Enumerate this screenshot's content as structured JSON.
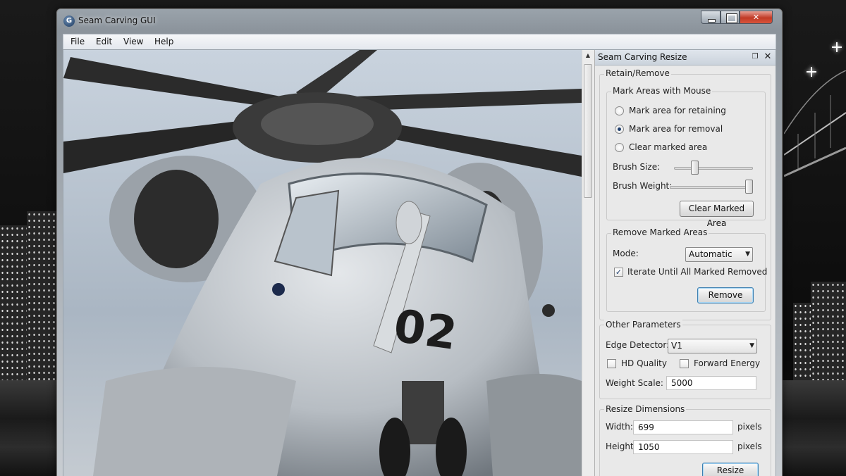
{
  "window": {
    "title": "Seam Carving GUI",
    "app_icon_letter": "G",
    "close_symbol": "✕"
  },
  "menu": [
    "File",
    "Edit",
    "View",
    "Help"
  ],
  "canvas": {
    "aircraft_marking": "02"
  },
  "dock": {
    "title": "Seam Carving Resize",
    "float_symbol": "❐",
    "close_symbol": "✕",
    "retain_remove": {
      "title": "Retain/Remove",
      "mark_areas": {
        "title": "Mark Areas with Mouse",
        "options": [
          "Mark area for retaining",
          "Mark area for removal",
          "Clear marked area"
        ],
        "selected_index": 1,
        "brush_size_label": "Brush Size:",
        "brush_size_value": 0.24,
        "brush_weight_label": "Brush Weight:",
        "brush_weight_value": 1.0,
        "clear_button": "Clear Marked Area"
      },
      "remove_marked": {
        "title": "Remove Marked Areas",
        "mode_label": "Mode:",
        "mode_value": "Automatic",
        "iterate_label": "Iterate Until All Marked Removed",
        "iterate_checked": true,
        "check_mark": "✓",
        "remove_button": "Remove"
      }
    },
    "other_parameters": {
      "title": "Other Parameters",
      "edge_detector_label": "Edge Detector:",
      "edge_detector_value": "V1",
      "hd_quality_label": "HD Quality",
      "hd_quality_checked": false,
      "forward_energy_label": "Forward Energy",
      "forward_energy_checked": false,
      "weight_scale_label": "Weight Scale:",
      "weight_scale_value": "5000"
    },
    "resize_dimensions": {
      "title": "Resize Dimensions",
      "width_label": "Width:",
      "width_value": "699",
      "height_label": "Height:",
      "height_value": "1050",
      "unit": "pixels",
      "resize_button": "Resize"
    }
  },
  "colors": {
    "title_bar": "#8c949c",
    "close_button": "#c13a26",
    "accent": "#3c7fb1"
  }
}
